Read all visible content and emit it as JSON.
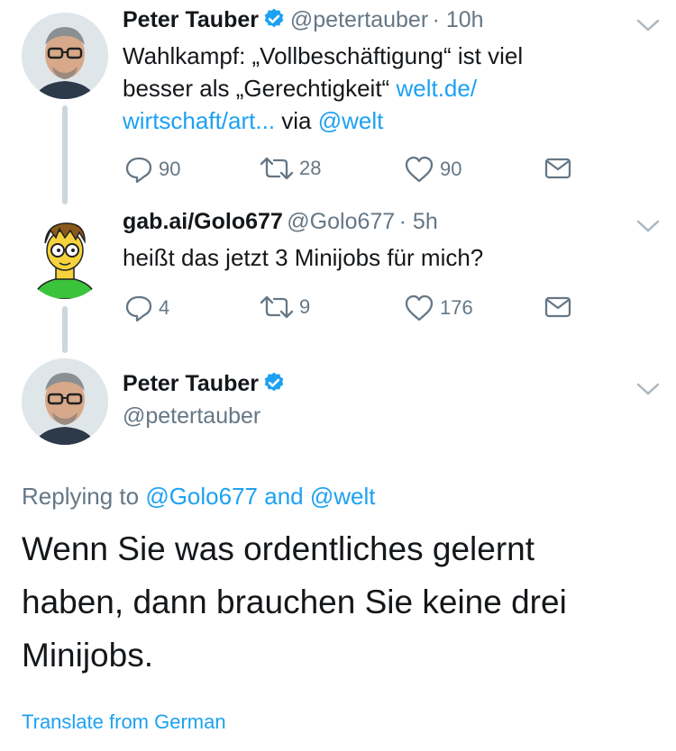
{
  "tweet1": {
    "name": "Peter Tauber",
    "handle": "@petertauber",
    "time": "· 10h",
    "text_line1": "Wahlkampf: „Vollbeschäftigung“ ist viel",
    "text_line2_a": "besser als „Gerechtigkeit“ ",
    "text_line2_link": "welt.de/",
    "text_line3_link": "wirtschaft/art...",
    "text_line3_via": " via ",
    "text_line3_mention": "@welt",
    "replies": "90",
    "retweets": "28",
    "likes": "90"
  },
  "tweet2": {
    "name": "gab.ai/Golo677",
    "handle": "@Golo677",
    "time": "· 5h",
    "text": "heißt das jetzt 3 Minijobs für mich?",
    "replies": "4",
    "retweets": "9",
    "likes": "176"
  },
  "main_tweet": {
    "name": "Peter Tauber",
    "handle": "@petertauber",
    "replying_prefix": "Replying to ",
    "replying_user1": "@Golo677",
    "replying_and": " and ",
    "replying_user2": "@welt",
    "text_line1": "Wenn Sie was ordentliches gelernt",
    "text_line2": "haben, dann brauchen Sie keine drei",
    "text_line3": "Minijobs.",
    "translate": "Translate from German"
  },
  "colors": {
    "accent": "#1da1f2",
    "muted": "#657786",
    "thread_line": "#ccd6dd"
  },
  "icons": [
    "verified-icon",
    "chevron-down-icon",
    "reply-icon",
    "retweet-icon",
    "like-icon",
    "dm-icon"
  ]
}
